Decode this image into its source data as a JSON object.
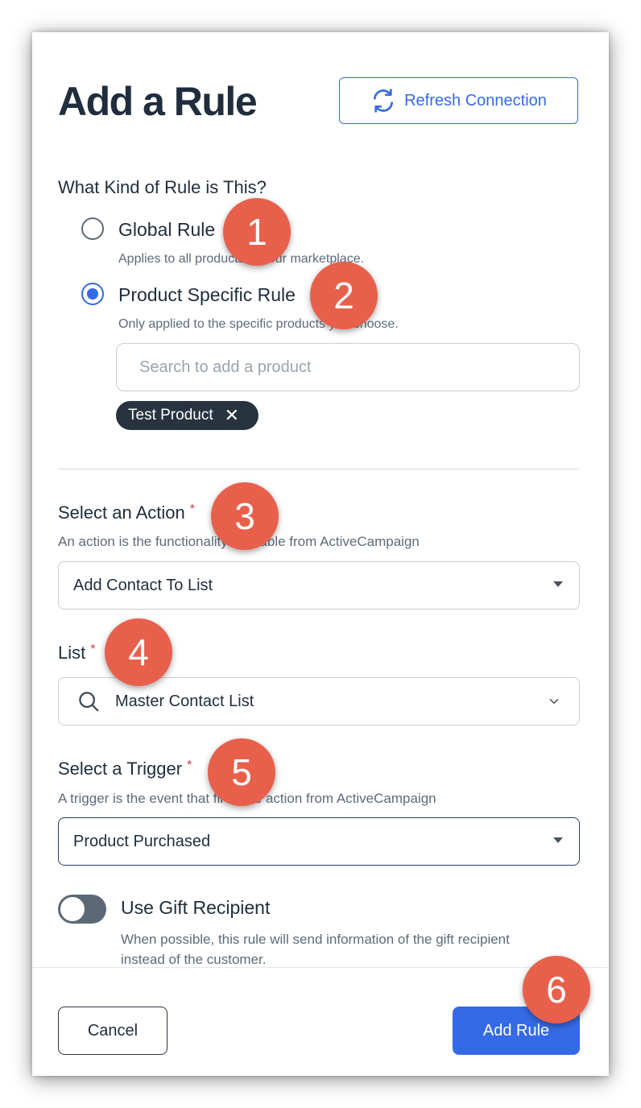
{
  "modal": {
    "title": "Add a Rule",
    "refresh_label": "Refresh Connection"
  },
  "rule_type": {
    "question": "What Kind of Rule is This?",
    "options": [
      {
        "label": "Global Rule",
        "description": "Applies to all products in your marketplace.",
        "selected": false
      },
      {
        "label": "Product Specific Rule",
        "description": "Only applied to the specific products you choose.",
        "selected": true
      }
    ],
    "search_placeholder": "Search to add a product",
    "chips": [
      {
        "label": "Test Product"
      }
    ]
  },
  "action": {
    "label": "Select an Action",
    "required_mark": "*",
    "help": "An action is the functionality available from ActiveCampaign",
    "value": "Add Contact To List"
  },
  "list": {
    "label": "List",
    "required_mark": "*",
    "value": "Master Contact List"
  },
  "trigger": {
    "label": "Select a Trigger",
    "required_mark": "*",
    "help": "A trigger is the event that fires the action from ActiveCampaign",
    "value": "Product Purchased"
  },
  "gift": {
    "label": "Use Gift Recipient",
    "description": "When possible, this rule will send information of the gift recipient instead of the customer.",
    "enabled": false
  },
  "footer": {
    "cancel_label": "Cancel",
    "submit_label": "Add Rule"
  },
  "badges": [
    "1",
    "2",
    "3",
    "4",
    "5",
    "6"
  ],
  "colors": {
    "accent": "#356ae6",
    "badge": "#e8604c",
    "chip": "#27333f",
    "toggle_off": "#5b6977"
  }
}
